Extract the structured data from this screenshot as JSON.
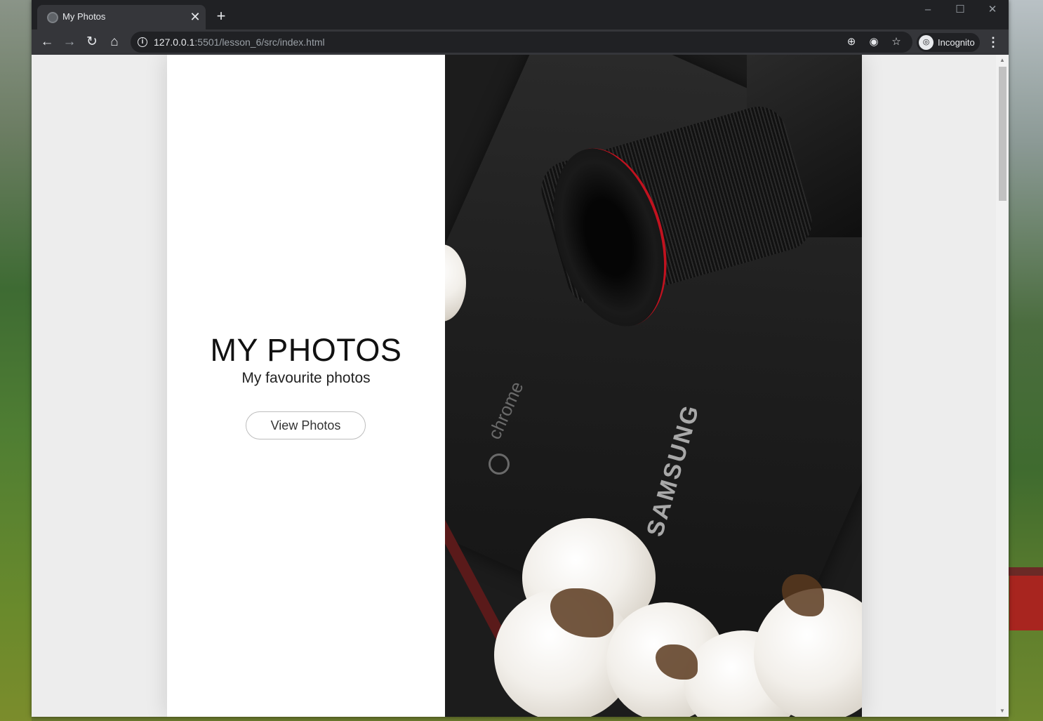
{
  "browser": {
    "tab": {
      "title": "My Photos"
    },
    "address": {
      "host": "127.0.0.1",
      "rest": ":5501/lesson_6/src/index.html"
    },
    "profile": {
      "label": "Incognito"
    },
    "window_controls": {
      "minimize": "–",
      "maximize": "☐",
      "close": "✕"
    }
  },
  "page": {
    "title": "MY PHOTOS",
    "subtitle": "My favourite photos",
    "button_label": "View Photos",
    "photo_text": {
      "laptop_os": "chrome",
      "laptop_brand": "SAMSUNG"
    }
  },
  "icons": {
    "back": "back-arrow-icon",
    "forward": "forward-arrow-icon",
    "reload": "reload-icon",
    "home": "home-icon",
    "info": "info-icon",
    "zoom": "zoom-icon",
    "tracking": "eye-slash-icon",
    "bookmark": "star-icon",
    "menu": "kebab-menu-icon"
  }
}
